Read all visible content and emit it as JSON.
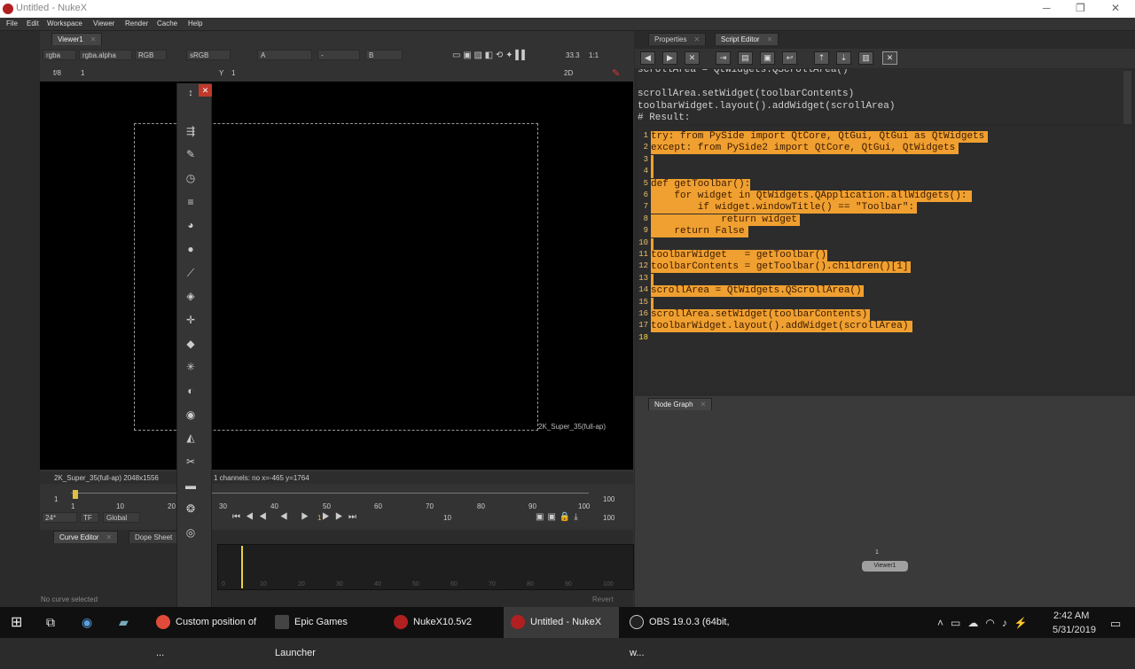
{
  "window": {
    "title": "Untitled - NukeX",
    "min": "─",
    "max": "❐",
    "close": "✕"
  },
  "menu": [
    "File",
    "Edit",
    "Workspace",
    "Viewer",
    "Render",
    "Cache",
    "Help"
  ],
  "viewer": {
    "tab": "Viewer1",
    "channels": "rgba",
    "alpha": "rgba.alpha",
    "rgb": "RGB",
    "colorspace": "sRGB",
    "input_a": "A",
    "input_b": "B",
    "dash": "-",
    "fstop": "f/8",
    "one": "1",
    "zoom": "33.3",
    "ratio": "1:1",
    "mode": "2D",
    "y_label": "Y",
    "y_value": "1",
    "format_label": "2K_Super_35(full-ap)",
    "info_format": "2K_Super_35(full-ap) 2048x1556",
    "info_stats": "1 channels: no  x=-465 y=1764"
  },
  "timeline": {
    "ticks_upper": [
      "1",
      "10",
      "20",
      "30",
      "40",
      "50",
      "60",
      "70",
      "80",
      "90",
      "100"
    ],
    "start": "1",
    "end": "100",
    "fps": "24*",
    "tf": "TF",
    "global": "Global",
    "frame": "1",
    "step": "10",
    "end_field": "100"
  },
  "curve": {
    "tab1": "Curve Editor",
    "tab2": "Dope Sheet",
    "status": "No curve selected",
    "revert": "Revert",
    "ticks": [
      "0",
      "10",
      "20",
      "30",
      "40",
      "50",
      "60",
      "70",
      "80",
      "90",
      "100"
    ]
  },
  "right_tabs": {
    "properties": "Properties",
    "script_editor": "Script Editor",
    "node_graph": "Node Graph"
  },
  "output_lines": [
    "scrollArea = QtWidgets.QScrollArea()",
    "",
    "scrollArea.setWidget(toolbarContents)",
    "toolbarWidget.layout().addWidget(scrollArea)",
    "# Result:"
  ],
  "code_lines": [
    {
      "n": "1",
      "t": "try: from PySide import QtCore, QtGui, QtGui as QtWidgets"
    },
    {
      "n": "2",
      "t": "except: from PySide2 import QtCore, QtGui, QtWidgets"
    },
    {
      "n": "3",
      "t": ""
    },
    {
      "n": "4",
      "t": ""
    },
    {
      "n": "5",
      "t": "def getToolbar():"
    },
    {
      "n": "6",
      "t": "    for widget in QtWidgets.QApplication.allWidgets():"
    },
    {
      "n": "7",
      "t": "        if widget.windowTitle() == \"Toolbar\":"
    },
    {
      "n": "8",
      "t": "            return widget"
    },
    {
      "n": "9",
      "t": "    return False"
    },
    {
      "n": "10",
      "t": ""
    },
    {
      "n": "11",
      "t": "toolbarWidget   = getToolbar()"
    },
    {
      "n": "12",
      "t": "toolbarContents = getToolbar().children()[1]"
    },
    {
      "n": "13",
      "t": ""
    },
    {
      "n": "14",
      "t": "scrollArea = QtWidgets.QScrollArea()"
    },
    {
      "n": "15",
      "t": ""
    },
    {
      "n": "16",
      "t": "scrollArea.setWidget(toolbarContents)"
    },
    {
      "n": "17",
      "t": "toolbarWidget.layout().addWidget(scrollArea)"
    },
    {
      "n": "18",
      "t": ""
    }
  ],
  "node": {
    "label": "Viewer1",
    "input": "1"
  },
  "taskbar": {
    "items": [
      "Custom position of ...",
      "Epic Games Launcher",
      "NukeX10.5v2",
      "Untitled - NukeX",
      "OBS 19.0.3 (64bit, w..."
    ],
    "time": "2:42 AM",
    "date": "5/31/2019"
  }
}
